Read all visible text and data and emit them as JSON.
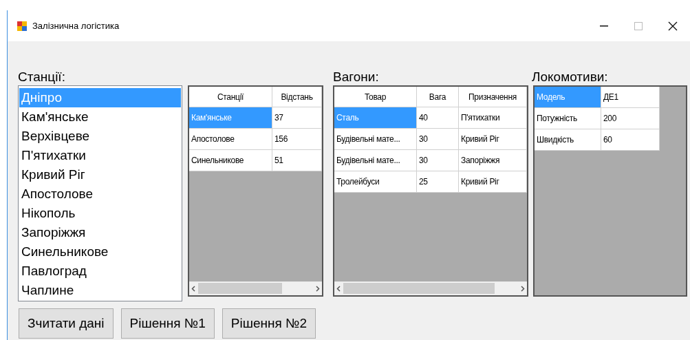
{
  "window": {
    "title": "Залізнична логістика"
  },
  "stations": {
    "label": "Станції:",
    "items": [
      {
        "text": "Дніпро",
        "selected": true
      },
      {
        "text": "Кам'янське",
        "selected": false
      },
      {
        "text": "Верхівцеве",
        "selected": false
      },
      {
        "text": "П'ятихатки",
        "selected": false
      },
      {
        "text": "Кривий Ріг",
        "selected": false
      },
      {
        "text": "Апостолове",
        "selected": false
      },
      {
        "text": "Нікополь",
        "selected": false
      },
      {
        "text": "Запоріжжя",
        "selected": false
      },
      {
        "text": "Синельникове",
        "selected": false
      },
      {
        "text": "Павлоград",
        "selected": false
      },
      {
        "text": "Чаплине",
        "selected": false
      }
    ]
  },
  "routes_grid": {
    "columns": [
      "Станції",
      "Відстань"
    ],
    "rows": [
      {
        "cells": [
          "Кам'янське",
          "37"
        ],
        "selected": true
      },
      {
        "cells": [
          "Апостолове",
          "156"
        ],
        "selected": false
      },
      {
        "cells": [
          "Синельникове",
          "51"
        ],
        "selected": false
      }
    ]
  },
  "wagons": {
    "label": "Вагони:",
    "columns": [
      "Товар",
      "Вага",
      "Призначення"
    ],
    "rows": [
      {
        "cells": [
          "Сталь",
          "40",
          "П'ятихатки"
        ],
        "selected": true
      },
      {
        "cells": [
          "Будівельні мате...",
          "30",
          "Кривий Ріг"
        ],
        "selected": false
      },
      {
        "cells": [
          "Будівельні мате...",
          "30",
          "Запоріжжя"
        ],
        "selected": false
      },
      {
        "cells": [
          "Тролейбуси",
          "25",
          "Кривий Ріг"
        ],
        "selected": false
      }
    ]
  },
  "locomotives": {
    "label": "Локомотиви:",
    "rows": [
      {
        "cells": [
          "Модель",
          "ДЕ1"
        ],
        "selected": true
      },
      {
        "cells": [
          "Потужність",
          "200"
        ],
        "selected": false
      },
      {
        "cells": [
          "Швидкість",
          "60"
        ],
        "selected": false
      }
    ]
  },
  "buttons": [
    "Зчитати дані",
    "Рішення №1",
    "Рішення №2"
  ]
}
